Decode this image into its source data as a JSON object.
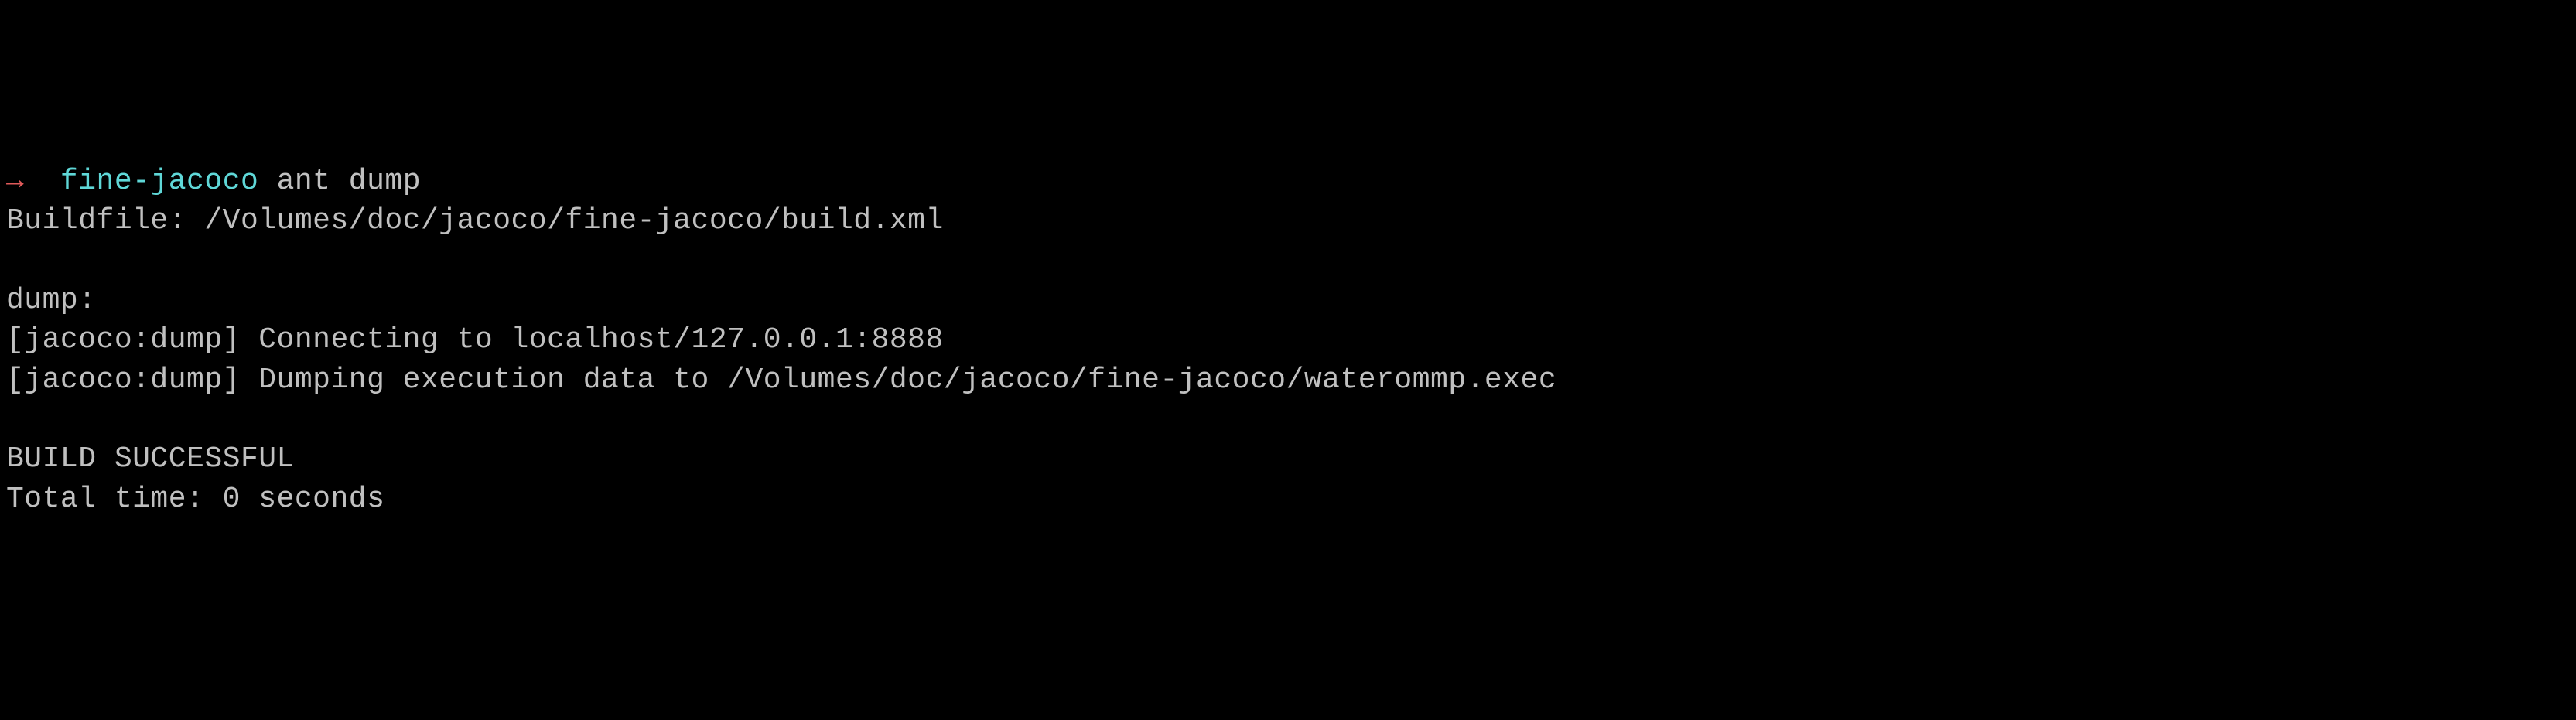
{
  "prompt": {
    "arrow": "→",
    "directory": "fine-jacoco",
    "command": "ant dump"
  },
  "output": {
    "buildfile": "Buildfile: /Volumes/doc/jacoco/fine-jacoco/build.xml",
    "target": "dump:",
    "connect": "[jacoco:dump] Connecting to localhost/127.0.0.1:8888",
    "dump": "[jacoco:dump] Dumping execution data to /Volumes/doc/jacoco/fine-jacoco/waterommp.exec",
    "status": "BUILD SUCCESSFUL",
    "time": "Total time: 0 seconds"
  }
}
